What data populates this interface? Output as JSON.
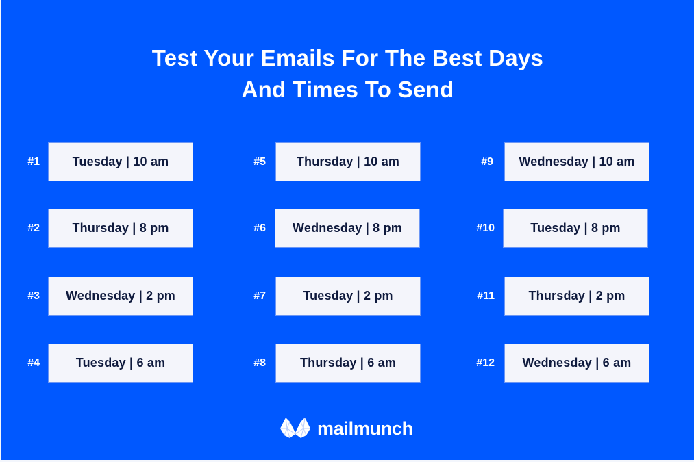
{
  "title": {
    "line1": "Test Your Emails For The Best Days",
    "line2": "And Times To Send"
  },
  "colors": {
    "background": "#0058ff",
    "box_fill": "#f4f5fb",
    "box_text": "#0f1a3d",
    "rank_text": "#ffffff"
  },
  "rankings": [
    {
      "rank": "#1",
      "day": "Tuesday",
      "time": "10 am",
      "label": "Tuesday | 10 am"
    },
    {
      "rank": "#2",
      "day": "Thursday",
      "time": "8 pm",
      "label": "Thursday | 8 pm"
    },
    {
      "rank": "#3",
      "day": "Wednesday",
      "time": "2 pm",
      "label": "Wednesday | 2 pm"
    },
    {
      "rank": "#4",
      "day": "Tuesday",
      "time": "6 am",
      "label": "Tuesday | 6 am"
    },
    {
      "rank": "#5",
      "day": "Thursday",
      "time": "10 am",
      "label": "Thursday | 10 am"
    },
    {
      "rank": "#6",
      "day": "Wednesday",
      "time": "8 pm",
      "label": "Wednesday | 8 pm"
    },
    {
      "rank": "#7",
      "day": "Tuesday",
      "time": "2 pm",
      "label": "Tuesday | 2 pm"
    },
    {
      "rank": "#8",
      "day": "Thursday",
      "time": "6 am",
      "label": "Thursday | 6 am"
    },
    {
      "rank": "#9",
      "day": "Wednesday",
      "time": "10 am",
      "label": "Wednesday | 10 am"
    },
    {
      "rank": "#10",
      "day": "Tuesday",
      "time": "8 pm",
      "label": "Tuesday | 8 pm"
    },
    {
      "rank": "#11",
      "day": "Thursday",
      "time": "2 pm",
      "label": "Thursday | 2 pm"
    },
    {
      "rank": "#12",
      "day": "Wednesday",
      "time": "6 am",
      "label": "Wednesday | 6 am"
    }
  ],
  "brand": {
    "name": "mailmunch",
    "icon": "mailmunch-m-logo-icon"
  }
}
